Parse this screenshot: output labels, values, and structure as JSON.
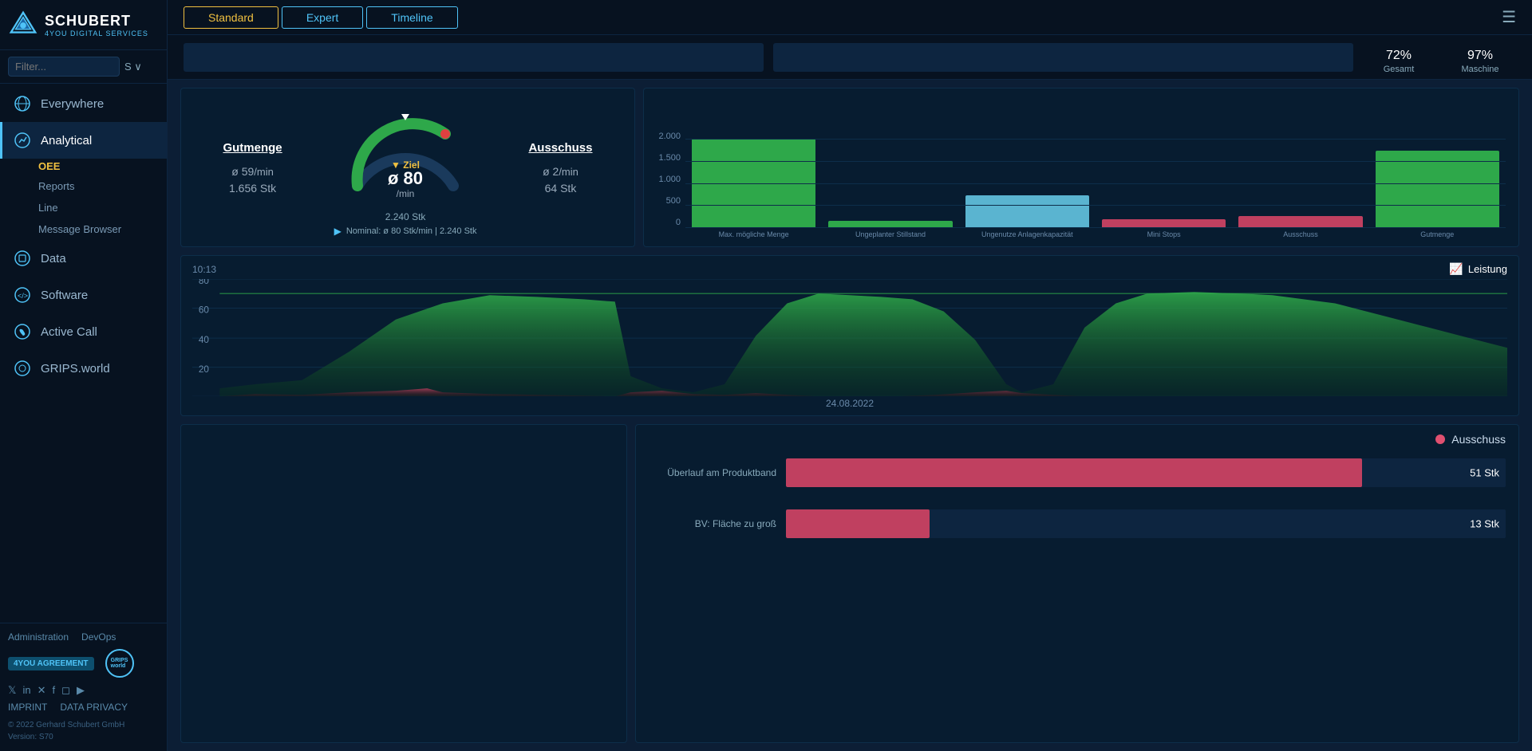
{
  "logo": {
    "name": "SCHUBERT",
    "sub": "4YOU DIGITAL SERVICES"
  },
  "filter": {
    "placeholder": "Filter...",
    "sv_label": "S ∨"
  },
  "nav": {
    "items": [
      {
        "id": "everywhere",
        "label": "Everywhere",
        "icon": "◎"
      },
      {
        "id": "analytical",
        "label": "Analytical",
        "icon": "◎",
        "active": true,
        "sub": [
          "OEE",
          "Reports",
          "Line",
          "Message Browser"
        ]
      },
      {
        "id": "data",
        "label": "Data",
        "icon": "◎"
      },
      {
        "id": "software",
        "label": "Software",
        "icon": "◎"
      },
      {
        "id": "activecall",
        "label": "Active Call",
        "icon": "◎"
      },
      {
        "id": "grips",
        "label": "GRIPS.world",
        "icon": "◎"
      }
    ],
    "oee_label": "OEE"
  },
  "footer": {
    "admin_label": "Administration",
    "devops_label": "DevOps",
    "agreement_label": "4YOU AGREEMENT",
    "grips_label": "GRIPS",
    "imprint_label": "IMPRINT",
    "data_privacy_label": "DATA PRIVACY",
    "copyright": "© 2022 Gerhard Schubert GmbH",
    "version": "Version: S70"
  },
  "topbar": {
    "tabs": [
      {
        "id": "standard",
        "label": "Standard",
        "active": true
      },
      {
        "id": "expert",
        "label": "Expert"
      },
      {
        "id": "timeline",
        "label": "Timeline"
      }
    ]
  },
  "stats": {
    "gesamt_value": "72",
    "gesamt_unit": "%",
    "gesamt_label": "Gesamt",
    "maschine_value": "97",
    "maschine_unit": "%",
    "maschine_label": "Maschine"
  },
  "gauge": {
    "gutmenge_label": "Gutmenge",
    "gutmenge_avg": "ø 59",
    "gutmenge_avg_unit": "/min",
    "gutmenge_stk": "1.656 Stk",
    "ziel_label": "▼ Ziel",
    "ziel_avg": "ø 80",
    "ziel_avg_unit": "/min",
    "ziel_stk": "2.240 Stk",
    "ausschuss_label": "Ausschuss",
    "ausschuss_avg": "ø 2",
    "ausschuss_avg_unit": "/min",
    "ausschuss_stk": "64 Stk",
    "nominal": "Nominal: ø 80 Stk/min | 2.240 Stk"
  },
  "barchart": {
    "y_labels": [
      "2.000",
      "1.500",
      "1.000",
      "500",
      "0"
    ],
    "bars": [
      {
        "label": "Max. mögliche Menge",
        "value": 1850,
        "color": "#2ea84a",
        "max": 2000
      },
      {
        "label": "Ungeplanter Stillstand",
        "value": 200,
        "color": "#2ea84a",
        "max": 2000
      },
      {
        "label": "Ungenutze Anlagenkapazität",
        "value": 500,
        "color": "#5ab4d0",
        "max": 2000
      },
      {
        "label": "Mini Stops",
        "value": 60,
        "color": "#c04060",
        "max": 2000
      },
      {
        "label": "Ausschuss",
        "value": 80,
        "color": "#c04060",
        "max": 2000
      },
      {
        "label": "Gutmenge",
        "value": 1600,
        "color": "#2ea84a",
        "max": 2000
      }
    ]
  },
  "linechart": {
    "leistung_label": "Leistung",
    "time_label": "10:13",
    "date_label": "24.08.2022",
    "y_labels": [
      "80",
      "60",
      "40",
      "20"
    ]
  },
  "ausschuss_chart": {
    "title": "Ausschuss",
    "bars": [
      {
        "label": "Überlauf am Produktband",
        "value": 51,
        "unit": "Stk",
        "pct": 80
      },
      {
        "label": "BV: Fläche zu groß",
        "value": 13,
        "unit": "Stk",
        "pct": 20
      }
    ]
  }
}
